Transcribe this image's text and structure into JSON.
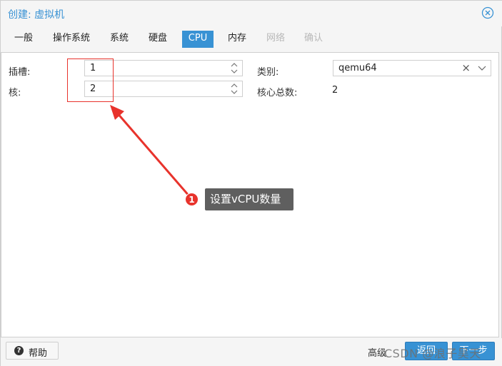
{
  "window": {
    "title": "创建: 虚拟机"
  },
  "tabs": [
    {
      "label": "一般",
      "state": "normal"
    },
    {
      "label": "操作系统",
      "state": "normal"
    },
    {
      "label": "系统",
      "state": "normal"
    },
    {
      "label": "硬盘",
      "state": "normal"
    },
    {
      "label": "CPU",
      "state": "active"
    },
    {
      "label": "内存",
      "state": "normal"
    },
    {
      "label": "网络",
      "state": "disabled"
    },
    {
      "label": "确认",
      "state": "disabled"
    }
  ],
  "form": {
    "sockets": {
      "label": "插槽:",
      "value": "1"
    },
    "cores": {
      "label": "核:",
      "value": "2"
    },
    "type": {
      "label": "类别:",
      "value": "qemu64",
      "clear": "×"
    },
    "total_cores": {
      "label": "核心总数:",
      "value": "2"
    }
  },
  "annotation": {
    "number": "1",
    "text": "设置vCPU数量",
    "color": "#e8332c"
  },
  "footer": {
    "help_label": "帮助",
    "help_icon": "?",
    "advanced_label": "高级",
    "back_label": "返回",
    "next_label": "下一步",
    "watermark": "CSDN @浪子吴天"
  },
  "colors": {
    "accent": "#3892d4",
    "highlight": "#e8332c"
  },
  "icons": {
    "close": "close-circle-icon",
    "spinner": "spinner-arrows-icon",
    "caret": "chevron-down-icon",
    "help": "question-circle-icon"
  }
}
